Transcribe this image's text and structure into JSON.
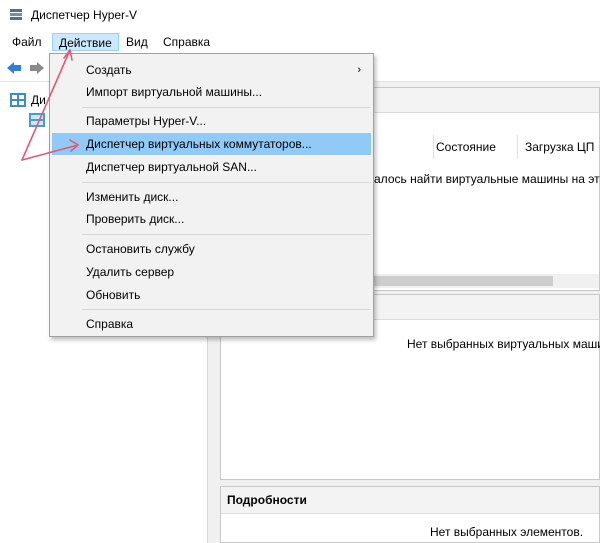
{
  "window": {
    "title": "Диспетчер Hyper-V"
  },
  "menubar": {
    "items": [
      "Файл",
      "Действие",
      "Вид",
      "Справка"
    ]
  },
  "tree": {
    "root_label": "Ди"
  },
  "columns": {
    "state": "Состояние",
    "cpu": "Загрузка ЦП"
  },
  "vm_list": {
    "empty_message": "далось найти виртуальные машины на это"
  },
  "checkpoints": {
    "empty_message": "Нет выбранных виртуальных машин"
  },
  "details": {
    "title": "Подробности",
    "empty_message": "Нет выбранных элементов."
  },
  "action_menu": {
    "items": [
      {
        "label": "Создать",
        "submenu": true
      },
      {
        "label": "Импорт виртуальной машины..."
      },
      {
        "label": "Параметры Hyper-V..."
      },
      {
        "label": "Диспетчер виртуальных коммутаторов...",
        "highlighted": true
      },
      {
        "label": "Диспетчер виртуальной SAN..."
      },
      {
        "label": "Изменить диск..."
      },
      {
        "label": "Проверить диск..."
      },
      {
        "label": "Остановить службу"
      },
      {
        "label": "Удалить сервер"
      },
      {
        "label": "Обновить"
      },
      {
        "label": "Справка"
      }
    ],
    "submenu_arrow": "›"
  },
  "colors": {
    "highlight": "#91c9f7",
    "active_menu": "#cce8ff",
    "annotation_arrow": "#e05a73"
  }
}
